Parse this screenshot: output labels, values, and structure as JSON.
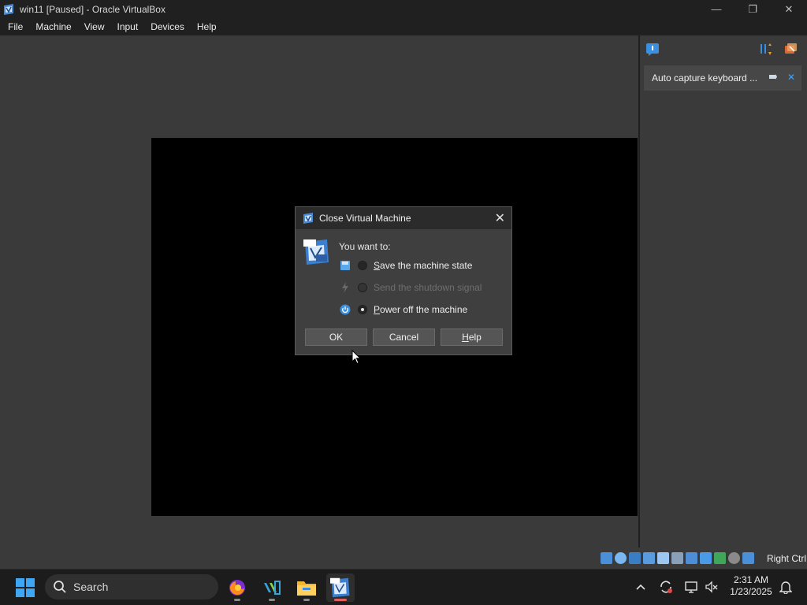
{
  "window": {
    "title": "win11 [Paused] - Oracle VirtualBox",
    "controls": {
      "minimize": "—",
      "restore": "❐",
      "close": "✕"
    }
  },
  "menu": [
    "File",
    "Machine",
    "View",
    "Input",
    "Devices",
    "Help"
  ],
  "notification_panel": {
    "message": "Auto capture keyboard ...",
    "close_glyph": "✕"
  },
  "dialog": {
    "title": "Close Virtual Machine",
    "close_glyph": "✕",
    "prompt": "You want to:",
    "options": [
      {
        "mnemonic": "S",
        "rest": "ave the machine state",
        "enabled": true,
        "checked": false
      },
      {
        "mnemonic": "",
        "rest": "Send the shutdown signal",
        "enabled": false,
        "checked": false
      },
      {
        "mnemonic": "P",
        "rest": "ower off the machine",
        "enabled": true,
        "checked": true
      }
    ],
    "buttons": {
      "ok": "OK",
      "cancel": "Cancel",
      "help_mnemonic": "H",
      "help_rest": "elp"
    }
  },
  "statusbar": {
    "host_key": "Right Ctrl"
  },
  "taskbar": {
    "search_placeholder": "Search",
    "time": "2:31 AM",
    "date": "1/23/2025"
  },
  "colors": {
    "accent": "#3aa3ff",
    "dialog_bg": "#3f3f3f",
    "vm_screen": "#000000"
  }
}
